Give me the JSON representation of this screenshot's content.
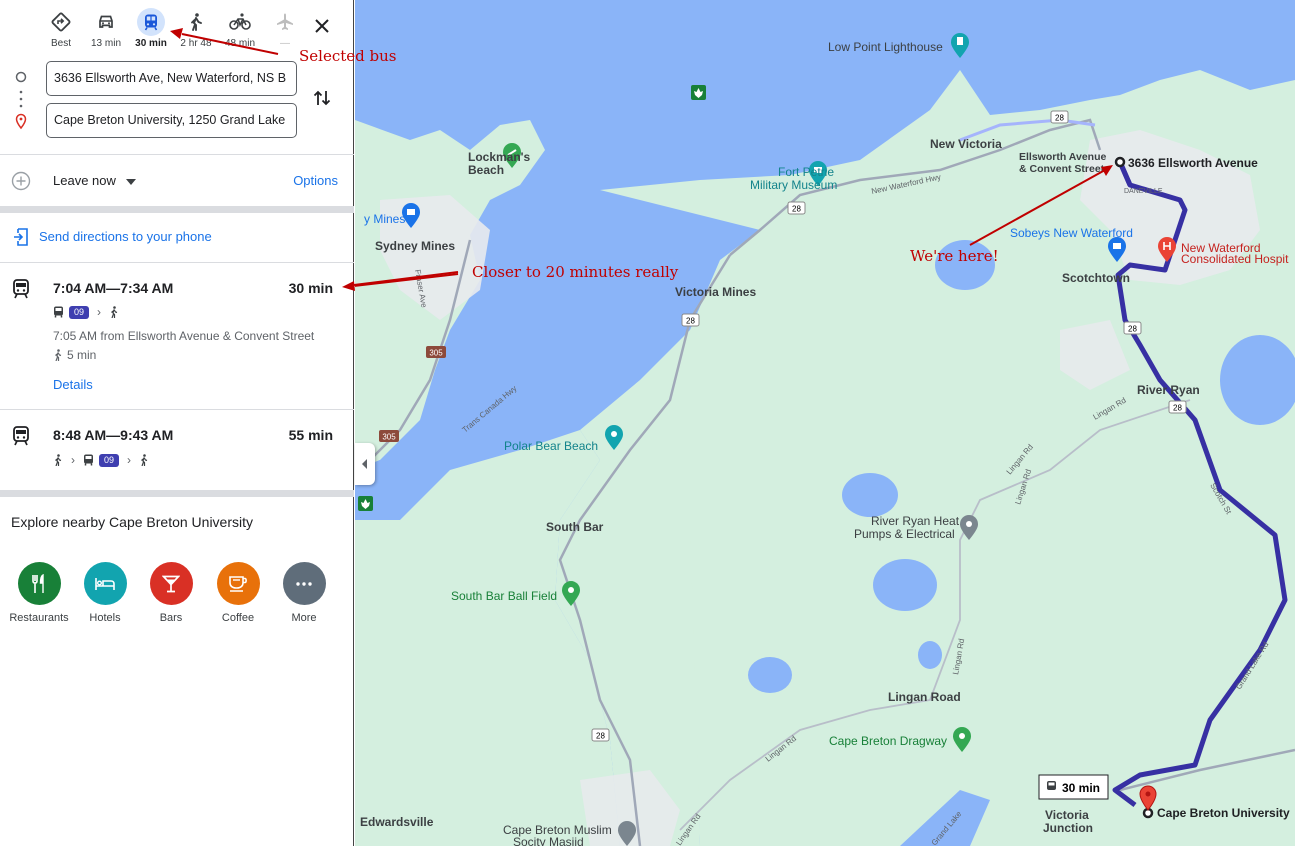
{
  "modes": [
    {
      "label": "Best",
      "icon": "best-route-icon"
    },
    {
      "label": "13 min",
      "icon": "car-icon"
    },
    {
      "label": "30 min",
      "icon": "transit-icon"
    },
    {
      "label": "2 hr 48",
      "icon": "walk-icon"
    },
    {
      "label": "48 min",
      "icon": "bike-icon"
    },
    {
      "label": "—",
      "icon": "flight-icon"
    }
  ],
  "origin": "3636 Ellsworth Ave, New Waterford, NS B",
  "destination": "Cape Breton University, 1250 Grand Lake",
  "leave": {
    "label": "Leave now",
    "options": "Options"
  },
  "send_directions": "Send directions to your phone",
  "routes": [
    {
      "times": "7:04 AM—7:34 AM",
      "duration": "30 min",
      "bus": "09",
      "departure": "7:05 AM from Ellsworth Avenue & Convent Street",
      "walk": "5 min",
      "details": "Details"
    },
    {
      "times": "8:48 AM—9:43 AM",
      "duration": "55 min",
      "bus": "09"
    }
  ],
  "explore": {
    "title": "Explore nearby Cape Breton University",
    "categories": [
      {
        "label": "Restaurants",
        "icon": "restaurant-icon",
        "color": "#188038"
      },
      {
        "label": "Hotels",
        "icon": "hotel-icon",
        "color": "#12a4af"
      },
      {
        "label": "Bars",
        "icon": "bar-icon",
        "color": "#d93025"
      },
      {
        "label": "Coffee",
        "icon": "coffee-icon",
        "color": "#e8710a"
      },
      {
        "label": "More",
        "icon": "more-icon",
        "color": "#5f6d7a"
      }
    ]
  },
  "map": {
    "places": {
      "low_point": "Low Point Lighthouse",
      "new_victoria": "New Victoria",
      "lockmans_1": "Lockman's",
      "lockmans_2": "Beach",
      "fort_petrie_1": "Fort Petrie",
      "fort_petrie_2": "Military Museum",
      "new_waterford_hwy": "New Waterford Hwy",
      "ellsworth_1": "Ellsworth Avenue",
      "ellsworth_2": "& Convent Street",
      "origin_label": "3636 Ellsworth Avenue",
      "daneville": "DANEVILLE",
      "sydney_mines": "Sydney Mines",
      "sydney_mines_store": "y Mines",
      "sobeys": "Sobeys New Waterford",
      "hospital_1": "New Waterford",
      "hospital_2": "Consolidated Hospit",
      "scotchtown": "Scotchtown",
      "victoria_mines": "Victoria Mines",
      "river_ryan": "River Ryan",
      "fraser_ave": "Fraser Ave",
      "trans_canada": "Trans Canada Hwy",
      "lingan_rd": "Lingan Rd",
      "scotch_st": "Scotch St",
      "polar_bear": "Polar Bear Beach",
      "south_bar": "South Bar",
      "heat_pumps_1": "River Ryan Heat",
      "heat_pumps_2": "Pumps & Electrical",
      "ball_field": "South Bar Ball Field",
      "grand_lake_rd": "Grand Lake Rd",
      "lingan_road": "Lingan Road",
      "dragway": "Cape Breton Dragway",
      "edwardsville": "Edwardsville",
      "masjid_1": "Cape Breton Muslim",
      "masjid_2": "Socity Masjid",
      "victoria_jct_1": "Victoria",
      "victoria_jct_2": "Junction",
      "cbu": "Cape Breton University",
      "grand_lake": "Grand Lake",
      "route_time": "30 min"
    },
    "shields": [
      "28",
      "305"
    ]
  },
  "annotations": {
    "selected_bus": "Selected bus",
    "closer": "Closer to 20 minutes really",
    "here": "We're here!"
  }
}
